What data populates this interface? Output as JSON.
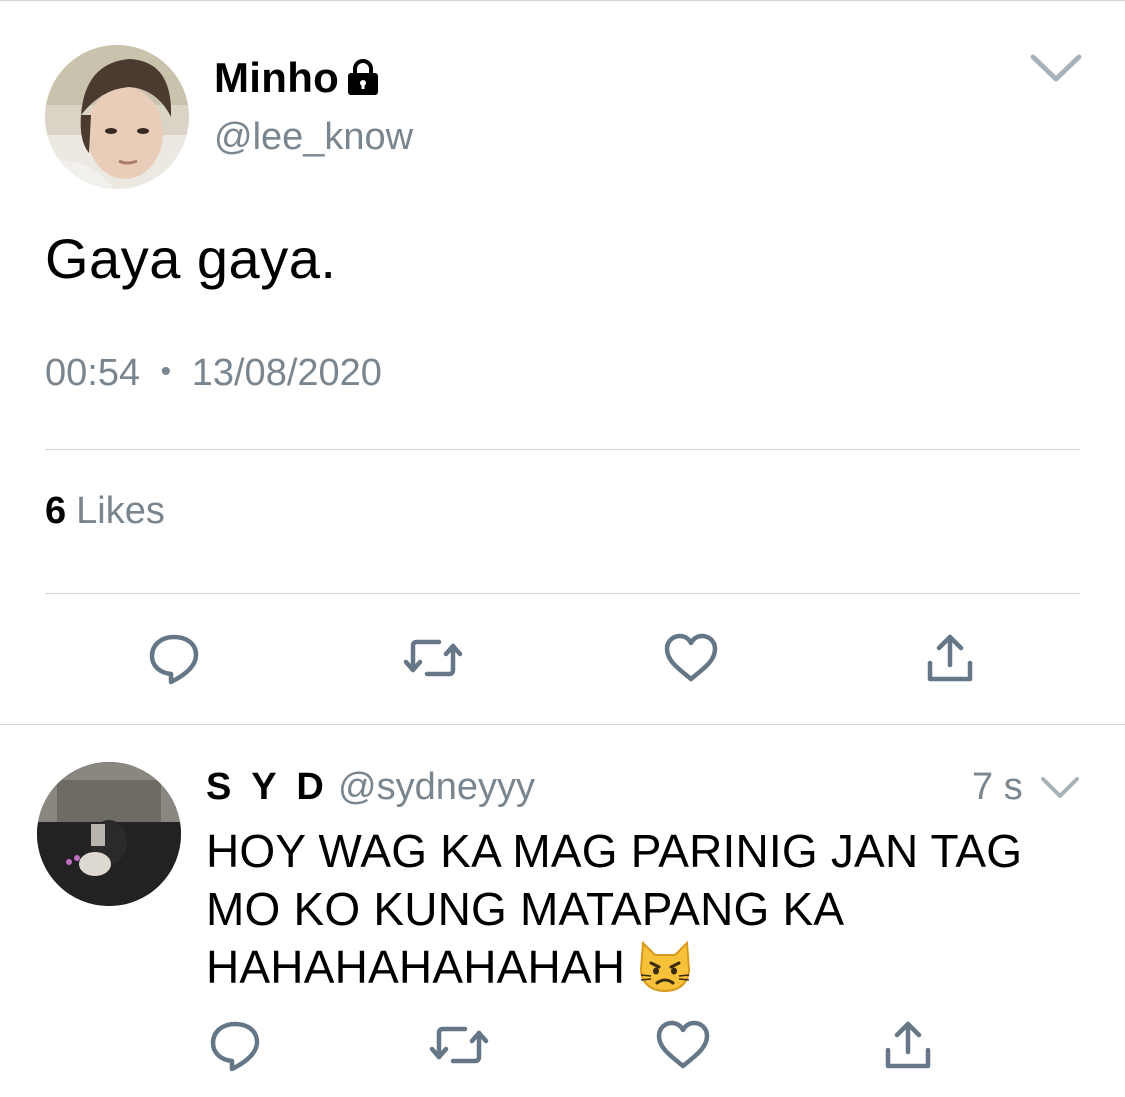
{
  "tweet": {
    "display_name": "Minho",
    "handle": "@lee_know",
    "text": "Gaya gaya.",
    "time": "00:54",
    "separator": "•",
    "date": "13/08/2020",
    "likes_count": "6",
    "likes_label": "Likes"
  },
  "reply": {
    "display_name": "S Y D",
    "handle": "@sydneyyy",
    "time_ago": "7 s",
    "text": "HOY WAG KA MAG PARINIG JAN TAG MO KO KUNG MATAPANG KA HAHAHAHAHAHAH"
  },
  "icons": {
    "lock": "lock-icon",
    "caret": "chevron-down-icon",
    "reply": "reply-icon",
    "retweet": "retweet-icon",
    "like": "heart-icon",
    "share": "share-icon",
    "emoji": "pouting-cat-face"
  },
  "colors": {
    "text": "#000000",
    "secondary": "#7a868f",
    "divider": "#cfd5da",
    "icon": "#657786"
  }
}
